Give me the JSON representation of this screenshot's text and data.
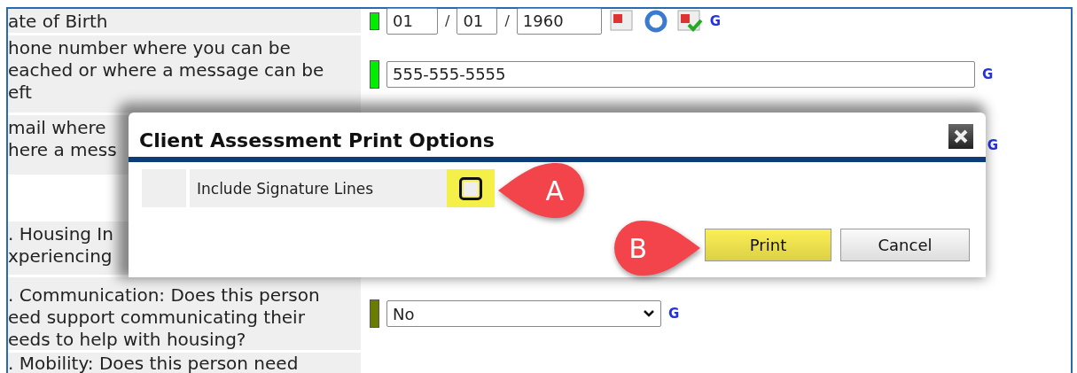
{
  "form": {
    "rows": [
      {
        "kind": "date",
        "label": "ate of Birth",
        "color": "#00ee00",
        "month": "01",
        "day": "01",
        "year": "1960",
        "separators": [
          "/",
          "/"
        ],
        "link": "G"
      },
      {
        "kind": "text",
        "label": "hone number where you can be\neached or where a message can be\neft",
        "color": "#00ee00",
        "value": "555-555-5555",
        "link": "G"
      },
      {
        "kind": "covered",
        "label": "mail where\nhere a mess",
        "link": "G"
      },
      {
        "kind": "blank"
      },
      {
        "kind": "covered",
        "label": ". Housing In\nxperiencing"
      },
      {
        "kind": "select",
        "label": ". Communication: Does this person\need support communicating their\needs to help with housing?",
        "color": "#6b7d00",
        "value": "No",
        "link": "G"
      },
      {
        "kind": "label",
        "label": ". Mobility: Does this person need"
      }
    ]
  },
  "dialog": {
    "title": "Client Assessment Print Options",
    "option": {
      "label": "Include Signature Lines",
      "checked": false
    },
    "buttons": [
      {
        "label": "Print",
        "primary": true
      },
      {
        "label": "Cancel",
        "primary": false
      }
    ]
  },
  "callouts": [
    {
      "label": "A"
    },
    {
      "label": "B"
    }
  ]
}
